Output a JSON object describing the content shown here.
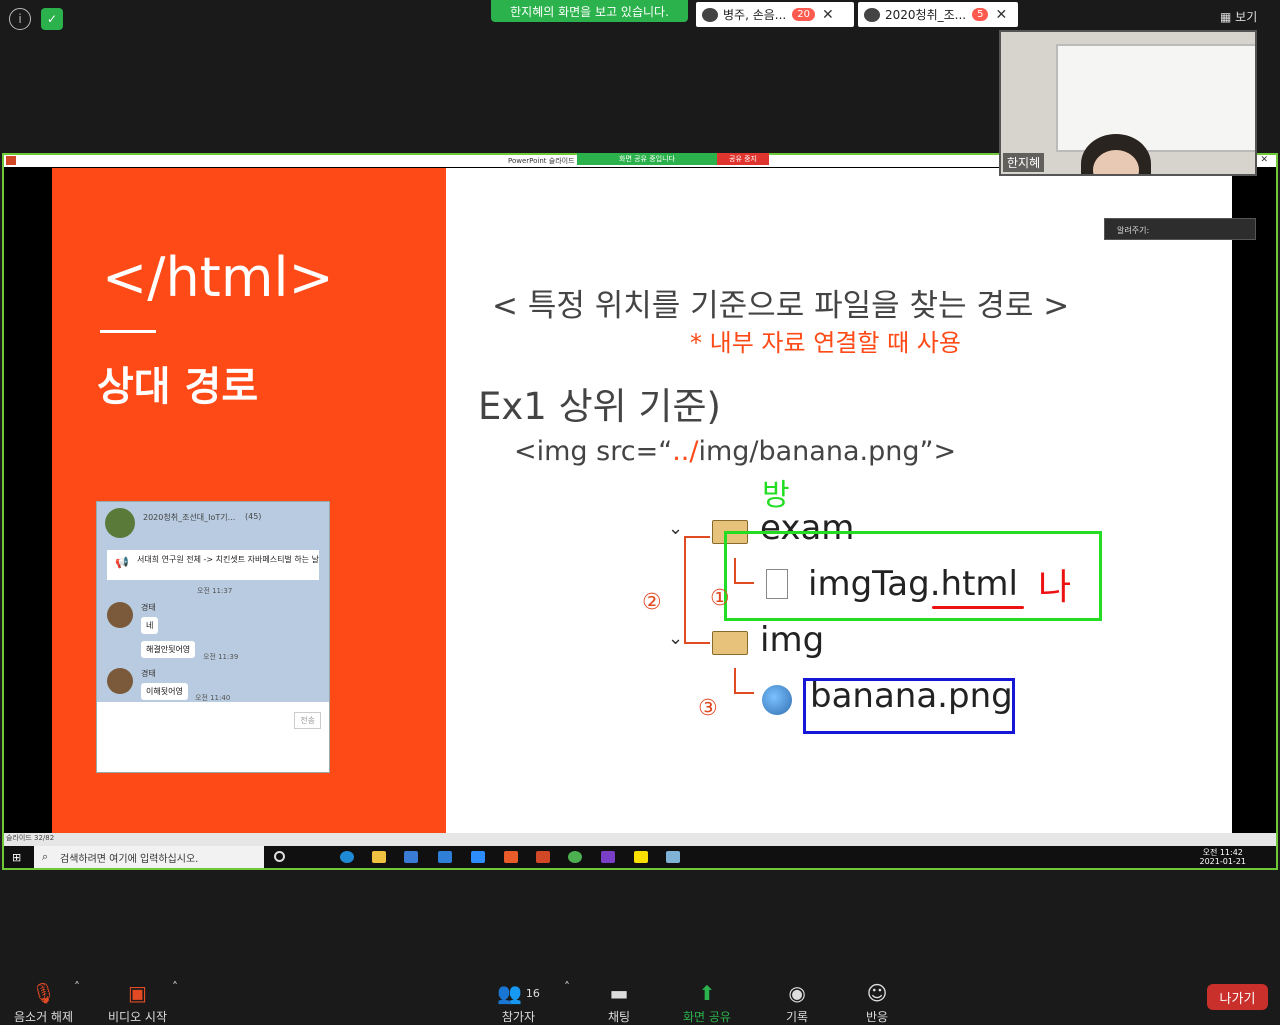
{
  "top": {
    "viewing_banner": "한지혜의 화면을 보고 있습니다.",
    "chat_tabs": [
      {
        "label": "병주, 손음...",
        "count": "20"
      },
      {
        "label": "2020청취_조...",
        "count": "5"
      }
    ],
    "view_label": "보기",
    "presenter_name": "한지혜"
  },
  "share": {
    "window_title": "PowerPoint 슬라이드",
    "sharing_label": "화면 공유 중입니다",
    "stop_label": "공유 중지",
    "tell_me": "알려주기:"
  },
  "slide": {
    "tag_title": "</html>",
    "section_title": "상대 경로",
    "heading": "< 특정 위치를 기준으로 파일을 찾는 경로 >",
    "subheading": "* 내부 자료 연결할 때 사용",
    "ex1": "Ex1   상위 기준)",
    "code_prefix": "<img src=“",
    "code_highlight": "../",
    "code_suffix": "img/banana.png”>",
    "annotation_bang": "방",
    "annotation_na": "나",
    "tree": {
      "folder1": "exam",
      "file1": "imgTag.html",
      "folder2": "img",
      "file2": "banana.png"
    },
    "circled": [
      "①",
      "②",
      "③"
    ]
  },
  "kakao": {
    "room": "2020청취_조선대_IoT기...",
    "members": "(45)",
    "notice": "서대희 연구원 전체 -> 치킨셋트 자바페스티벌 하는 날",
    "messages": [
      {
        "name": "경태",
        "text": "네",
        "time": ""
      },
      {
        "name": "",
        "text": "해결안됫어영",
        "time": "오전 11:39"
      },
      {
        "name": "경태",
        "text": "이해됫어영",
        "time": "오전 11:40"
      }
    ],
    "prev_time": "오전 11:37",
    "send": "전송"
  },
  "status": {
    "slide_count": "슬라이드 32/82"
  },
  "taskbar": {
    "search_placeholder": "검색하려면 여기에 입력하십시오.",
    "time": "오전 11:42",
    "date": "2021-01-21"
  },
  "controls": {
    "unmute": "음소거 해제",
    "start_video": "비디오 시작",
    "participants": "참가자",
    "participant_count": "16",
    "chat": "채팅",
    "share_screen": "화면 공유",
    "record": "기록",
    "reactions": "반응",
    "leave": "나가기"
  }
}
